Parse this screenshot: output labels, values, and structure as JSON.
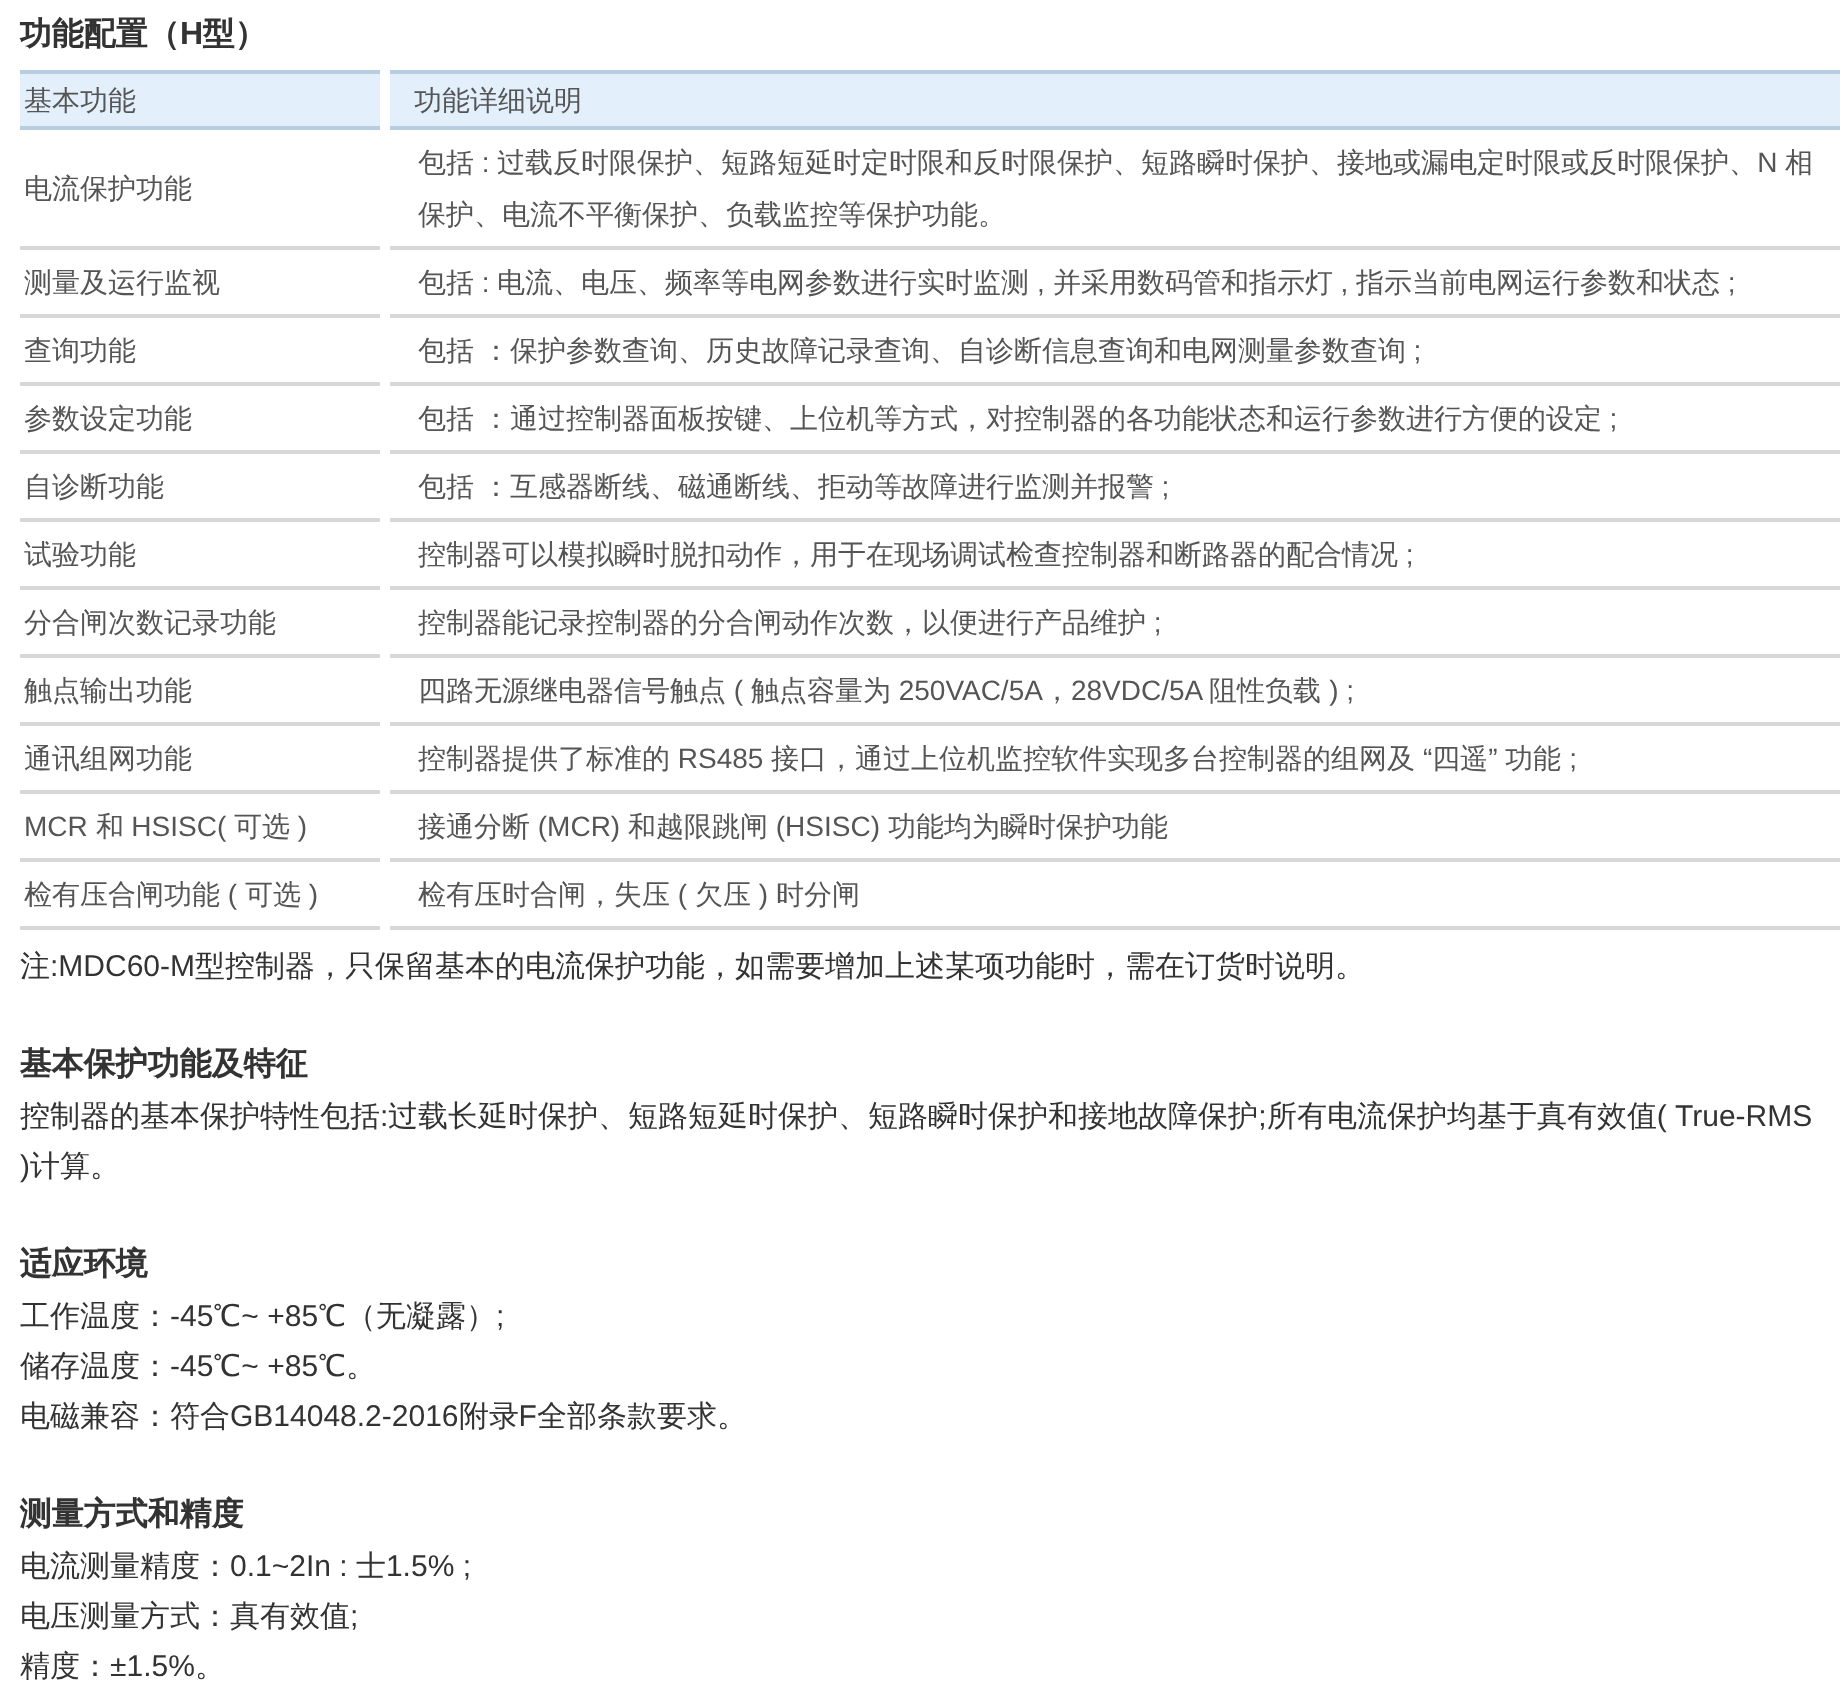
{
  "title": "功能配置（H型）",
  "table": {
    "columns": [
      "基本功能",
      "功能详细说明"
    ],
    "rows": [
      {
        "function": "电流保护功能",
        "description": "包括 : 过载反时限保护、短路短延时定时限和反时限保护、短路瞬时保护、接地或漏电定时限或反时限保护、N 相保护、电流不平衡保护、负载监控等保护功能。"
      },
      {
        "function": "测量及运行监视",
        "description": "包括 : 电流、电压、频率等电网参数进行实时监测 , 并采用数码管和指示灯 , 指示当前电网运行参数和状态 ;"
      },
      {
        "function": "查询功能",
        "description": "包括 ：保护参数查询、历史故障记录查询、自诊断信息查询和电网测量参数查询 ;"
      },
      {
        "function": "参数设定功能",
        "description": "包括 ：通过控制器面板按键、上位机等方式，对控制器的各功能状态和运行参数进行方便的设定 ;"
      },
      {
        "function": "自诊断功能",
        "description": "包括 ：互感器断线、磁通断线、拒动等故障进行监测并报警 ;"
      },
      {
        "function": "试验功能",
        "description": "控制器可以模拟瞬时脱扣动作，用于在现场调试检查控制器和断路器的配合情况 ;"
      },
      {
        "function": "分合闸次数记录功能",
        "description": "控制器能记录控制器的分合闸动作次数，以便进行产品维护 ;"
      },
      {
        "function": "触点输出功能",
        "description": "四路无源继电器信号触点 ( 触点容量为 250VAC/5A，28VDC/5A  阻性负载 ) ;"
      },
      {
        "function": "通讯组网功能",
        "description": "控制器提供了标准的 RS485 接口，通过上位机监控软件实现多台控制器的组网及 “四遥” 功能 ;"
      },
      {
        "function": "MCR 和 HSISC( 可选 )",
        "description": "接通分断 (MCR) 和越限跳闸 (HSISC) 功能均为瞬时保护功能"
      },
      {
        "function": "检有压合闸功能 ( 可选 )",
        "description": "检有压时合闸，失压 ( 欠压 ) 时分闸"
      }
    ]
  },
  "note": "注:MDC60-M型控制器，只保留基本的电流保护功能，如需要增加上述某项功能时，需在订货时说明。",
  "sections": [
    {
      "heading": "基本保护功能及特征",
      "lines": [
        "控制器的基本保护特性包括:过载长延时保护、短路短延时保护、短路瞬时保护和接地故障保护;所有电流保护均基于真有效值( True-RMS )计算。"
      ]
    },
    {
      "heading": "适应环境",
      "lines": [
        "工作温度：-45℃~ +85℃（无凝露）;",
        "储存温度：-45℃~ +85℃。",
        "电磁兼容：符合GB14048.2-2016附录F全部条款要求。"
      ]
    },
    {
      "heading": "测量方式和精度",
      "lines": [
        "电流测量精度：0.1~2In : 士1.5% ;",
        "电压测量方式：真有效值;",
        "精度：±1.5%。"
      ]
    }
  ]
}
